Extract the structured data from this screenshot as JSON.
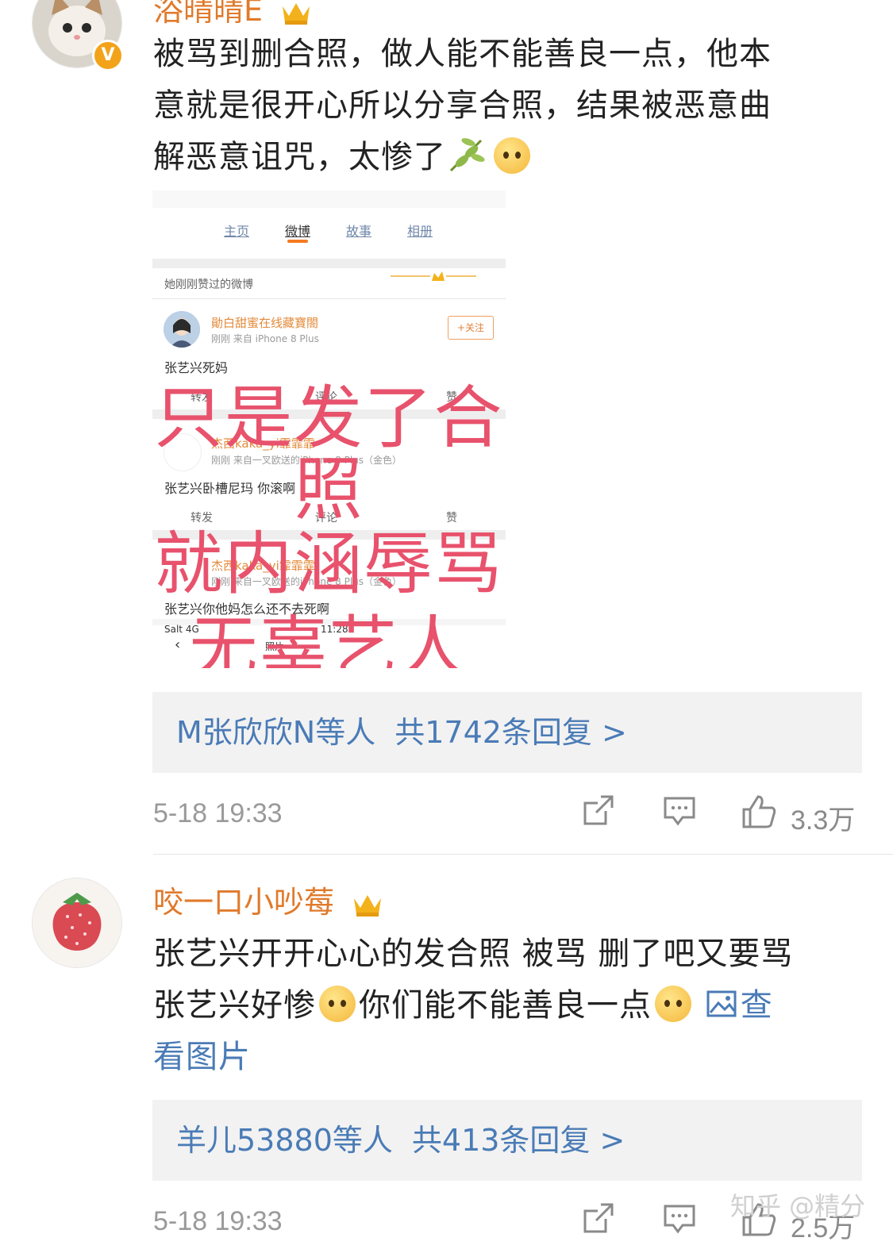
{
  "comments": [
    {
      "username": "浴晴晴E",
      "text_lines": [
        "被骂到删合照，做人能不能善良一点，他本",
        "意就是很开心所以分享合照，结果被恶意曲",
        "解恶意诅咒，太惨了"
      ],
      "embed": {
        "tabs": [
          "主页",
          "微博",
          "故事",
          "相册"
        ],
        "liked_header": "她刚刚赞过的微博",
        "posts": [
          {
            "name": "勛白甜蜜在线藏寶閤",
            "meta": "刚刚  来自 iPhone 8 Plus",
            "text": "张艺兴死妈",
            "follow": "+关注"
          },
          {
            "name": "杰西kaka_yi霏霏霏",
            "meta": "刚刚  来自一叉欧送的iPhone 8 Plus（金色）",
            "text": "张艺兴卧槽尼玛 你滚啊"
          },
          {
            "name": "杰西kaka_yi霏霏霏",
            "meta": "刚刚  来自一叉欧送的iPhone 8 Plus（金色）",
            "text": "张艺兴你他妈怎么还不去死啊"
          }
        ],
        "actions": [
          "转发",
          "评论",
          "赞"
        ],
        "status_bar": "Salt  4G",
        "status_time": "11:28",
        "bottom_title": "照片",
        "overlay_lines": [
          "只是发了合",
          "照",
          "就内涵辱骂",
          "无辜艺人"
        ]
      },
      "reply_who": "M张欣欣N等人",
      "reply_count": "共1742条回复 >",
      "time": "5-18 19:33",
      "likes": "3.3万"
    },
    {
      "username": "咬一口小吵莓",
      "text_line1": "张艺兴开开心心的发合照 被骂 删了吧又要骂",
      "text_line2a": "张艺兴好惨",
      "text_line2b": "你们能不能善良一点",
      "view_pic_a": "查",
      "view_pic_b": "看图片",
      "reply_who": "羊儿53880等人",
      "reply_count": "共413条回复 >",
      "time": "5-18 19:33",
      "likes": "2.5万"
    }
  ],
  "watermark": "知乎 @精分",
  "colors": {
    "username": "#e07a2b",
    "link": "#4a7bb6",
    "overlay": "#e8526c"
  }
}
